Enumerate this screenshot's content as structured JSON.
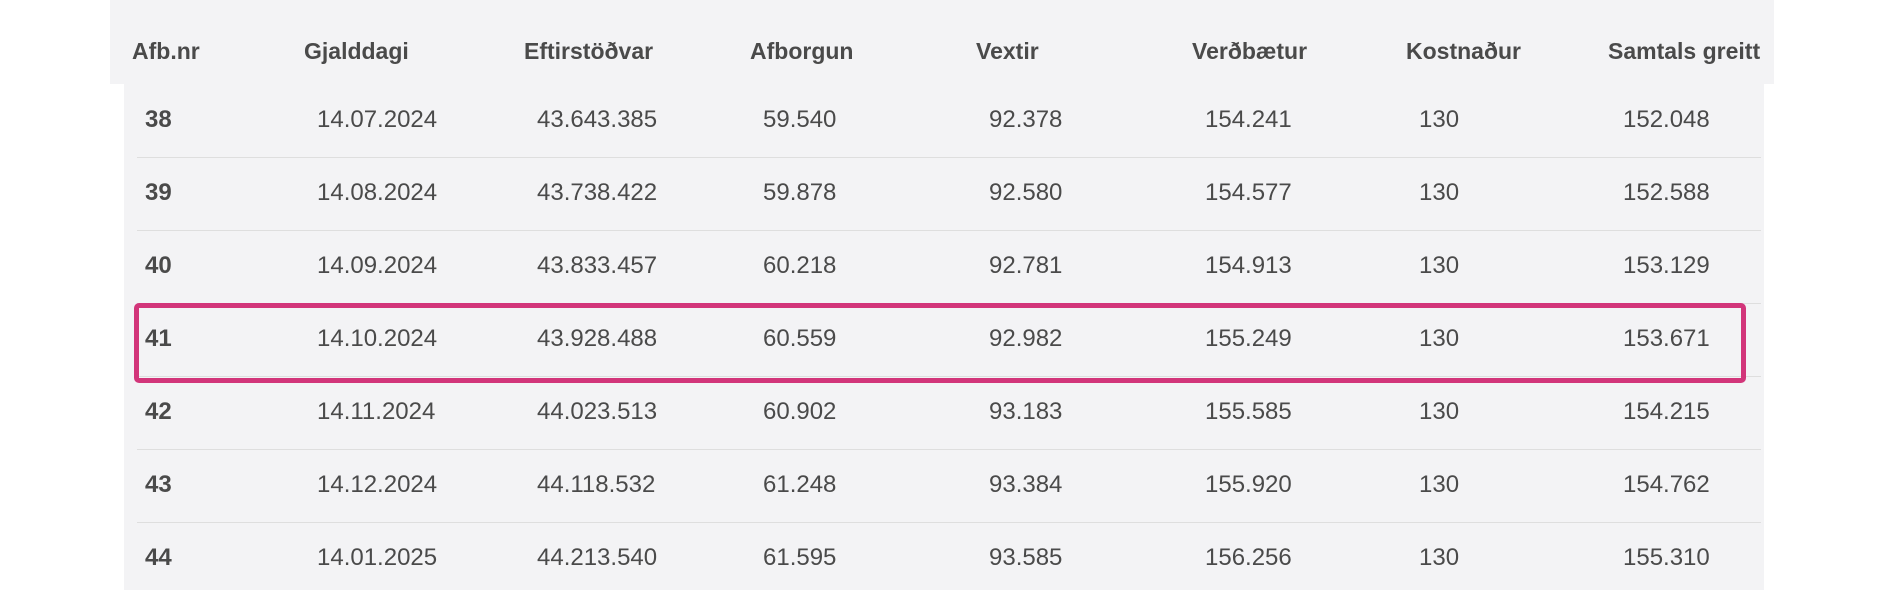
{
  "colors": {
    "header_bg": "#f3f3f5",
    "body_bg": "#f3f3f5",
    "text": "#4a4a4a",
    "row_divider": "#dedede",
    "highlight_border": "#d2357a"
  },
  "table": {
    "headers": [
      "Afb.nr",
      "Gjalddagi",
      "Eftirstöðvar",
      "Afborgun",
      "Vextir",
      "Verðbætur",
      "Kostnaður",
      "Samtals greitt"
    ],
    "rows": [
      [
        "38",
        "14.07.2024",
        "43.643.385",
        "59.540",
        "92.378",
        "154.241",
        "130",
        "152.048"
      ],
      [
        "39",
        "14.08.2024",
        "43.738.422",
        "59.878",
        "92.580",
        "154.577",
        "130",
        "152.588"
      ],
      [
        "40",
        "14.09.2024",
        "43.833.457",
        "60.218",
        "92.781",
        "154.913",
        "130",
        "153.129"
      ],
      [
        "41",
        "14.10.2024",
        "43.928.488",
        "60.559",
        "92.982",
        "155.249",
        "130",
        "153.671"
      ],
      [
        "42",
        "14.11.2024",
        "44.023.513",
        "60.902",
        "93.183",
        "155.585",
        "130",
        "154.215"
      ],
      [
        "43",
        "14.12.2024",
        "44.118.532",
        "61.248",
        "93.384",
        "155.920",
        "130",
        "154.762"
      ],
      [
        "44",
        "14.01.2025",
        "44.213.540",
        "61.595",
        "93.585",
        "156.256",
        "130",
        "155.310"
      ]
    ],
    "highlighted_row_afb_nr": "41"
  }
}
